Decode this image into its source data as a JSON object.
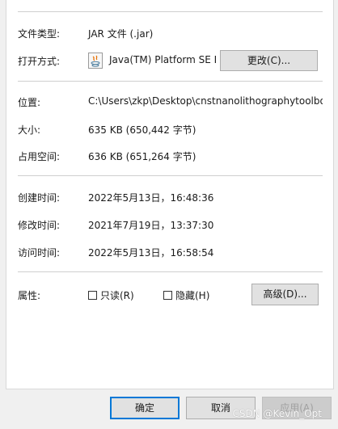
{
  "file_type": {
    "label": "文件类型:",
    "value": "JAR 文件 (.jar)"
  },
  "open_with": {
    "label": "打开方式:",
    "app": "Java(TM) Platform SE I",
    "app_icon": "java-icon",
    "change_button": "更改(C)..."
  },
  "location": {
    "label": "位置:",
    "value": "C:\\Users\\zkp\\Desktop\\cnstnanolithographytoolbo"
  },
  "size": {
    "label": "大小:",
    "value": "635 KB (650,442 字节)"
  },
  "size_on_disk": {
    "label": "占用空间:",
    "value": "636 KB (651,264 字节)"
  },
  "created": {
    "label": "创建时间:",
    "value": "2022年5月13日，16:48:36"
  },
  "modified": {
    "label": "修改时间:",
    "value": "2021年7月19日，13:37:30"
  },
  "accessed": {
    "label": "访问时间:",
    "value": "2022年5月13日，16:58:54"
  },
  "attributes": {
    "label": "属性:",
    "readonly_label": "只读(R)",
    "hidden_label": "隐藏(H)",
    "advanced_button": "高级(D)..."
  },
  "footer": {
    "ok": "确定",
    "cancel": "取消",
    "apply": "应用(A)"
  },
  "watermark": "CSDN @Kevin_Opt",
  "colors": {
    "primary_border": "#0078d7",
    "panel_bg": "#ffffff",
    "window_bg": "#f0f0f0"
  }
}
